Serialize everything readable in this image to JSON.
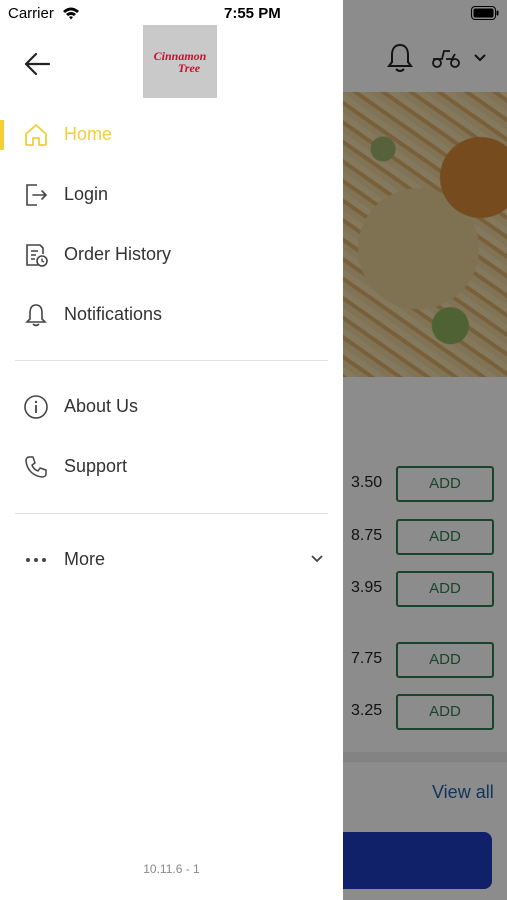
{
  "status_bar": {
    "carrier": "Carrier",
    "time": "7:55 PM"
  },
  "drawer": {
    "logo": {
      "line1": "Cinnamon",
      "line2": "Tree"
    },
    "items": [
      {
        "label": "Home",
        "icon": "home-icon",
        "active": true
      },
      {
        "label": "Login",
        "icon": "login-icon"
      },
      {
        "label": "Order History",
        "icon": "order-history-icon"
      },
      {
        "label": "Notifications",
        "icon": "bell-icon"
      }
    ],
    "secondary": [
      {
        "label": "About Us",
        "icon": "info-icon"
      },
      {
        "label": "Support",
        "icon": "phone-icon"
      }
    ],
    "more": {
      "label": "More",
      "icon": "more-dots-icon"
    },
    "version": "10.11.6 - 1"
  },
  "background": {
    "menu": [
      {
        "price": "3.50",
        "button": "ADD"
      },
      {
        "price": "8.75",
        "button": "ADD"
      },
      {
        "price": "3.95",
        "button": "ADD"
      },
      {
        "price": "7.75",
        "button": "ADD"
      },
      {
        "price": "3.25",
        "button": "ADD"
      }
    ],
    "view_all": "View all"
  },
  "colors": {
    "accent": "#f2cf3a",
    "add_button": "#2e7d4f",
    "checkout": "#1e3bbf",
    "link": "#1f5fa8",
    "logo_text": "#c8102e"
  }
}
